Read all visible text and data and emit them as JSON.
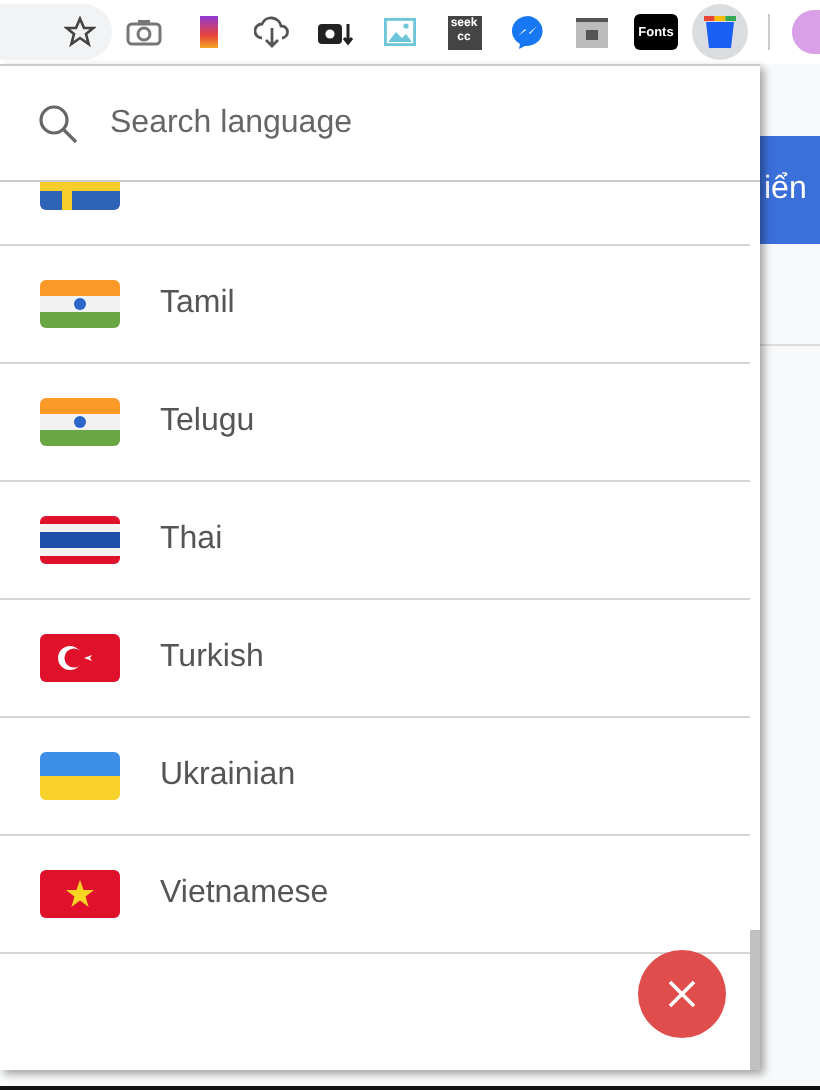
{
  "toolbar": {
    "seek_logo": {
      "line_1": "seek",
      "line_2": "cc"
    },
    "fonts_logo": "Fonts"
  },
  "background": {
    "button_label": "iển"
  },
  "popup": {
    "search": {
      "placeholder": "Search language"
    },
    "languages": [
      {
        "kind": "sweden"
      },
      {
        "name": "Tamil",
        "kind": "india"
      },
      {
        "name": "Telugu",
        "kind": "india"
      },
      {
        "name": "Thai",
        "kind": "thailand"
      },
      {
        "name": "Turkish",
        "kind": "turkey"
      },
      {
        "name": "Ukrainian",
        "kind": "ukraine"
      },
      {
        "name": "Vietnamese",
        "kind": "vietnam"
      }
    ]
  }
}
